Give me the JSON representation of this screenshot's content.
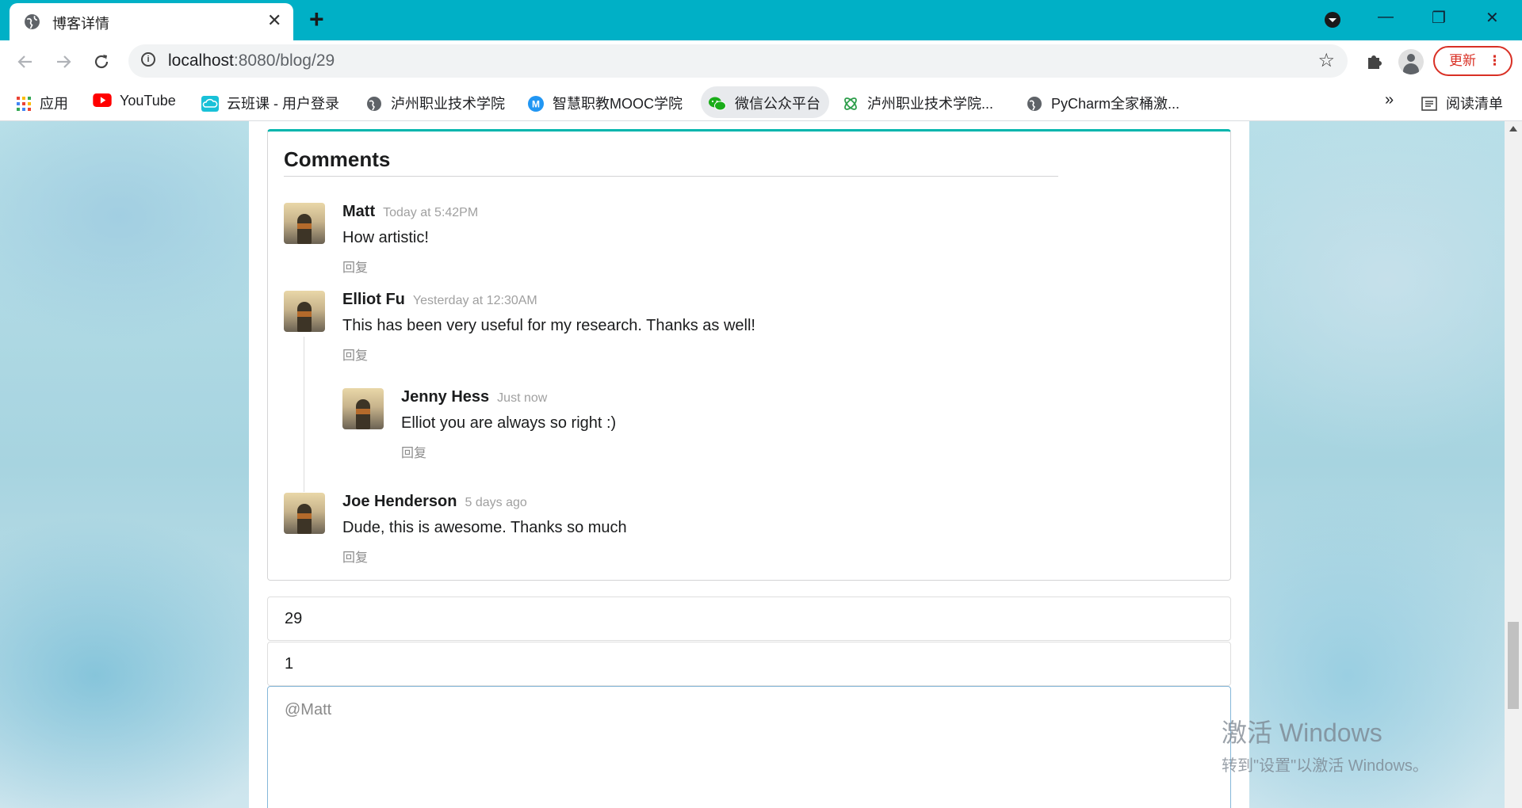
{
  "browser": {
    "tab_title": "博客详情",
    "tab_close": "✕",
    "new_tab": "+",
    "url_host": "localhost",
    "url_path": ":8080/blog/29",
    "update_label": "更新",
    "more_dots": "⋮",
    "win_minimize": "—",
    "win_restore": "❐",
    "win_close": "✕",
    "theme_color": "#00b0c6"
  },
  "bookmarks": {
    "items": [
      {
        "label": "应用",
        "icon": "apps-grid-icon"
      },
      {
        "label": "YouTube",
        "icon": "youtube-icon"
      },
      {
        "label": "云班课 - 用户登录",
        "icon": "cloud-icon"
      },
      {
        "label": "泸州职业技术学院",
        "icon": "globe-icon"
      },
      {
        "label": "智慧职教MOOC学院",
        "icon": "mooc-icon"
      },
      {
        "label": "微信公众平台",
        "icon": "wechat-icon"
      },
      {
        "label": "泸州职业技术学院...",
        "icon": "college-icon"
      },
      {
        "label": "PyCharm全家桶激...",
        "icon": "globe-icon"
      }
    ],
    "overflow": "»",
    "reading_list": "阅读清单"
  },
  "comments": {
    "header": "Comments",
    "items": [
      {
        "author": "Matt",
        "date": "Today at 5:42PM",
        "text": "How artistic!",
        "reply": "回复"
      },
      {
        "author": "Elliot Fu",
        "date": "Yesterday at 12:30AM",
        "text": "This has been very useful for my research. Thanks as well!",
        "reply": "回复"
      },
      {
        "author": "Jenny Hess",
        "date": "Just now",
        "text": "Elliot you are always so right :)",
        "reply": "回复"
      },
      {
        "author": "Joe Henderson",
        "date": "5 days ago",
        "text": "Dude, this is awesome. Thanks so much",
        "reply": "回复"
      }
    ]
  },
  "form": {
    "blog_id_value": "29",
    "parent_id_value": "1",
    "content_placeholder": "@Matt"
  },
  "watermark": {
    "line1": "激活 Windows",
    "line2": "转到\"设置\"以激活 Windows。"
  },
  "colors": {
    "accent_teal": "#00b5ad",
    "update_red": "#d93025"
  }
}
